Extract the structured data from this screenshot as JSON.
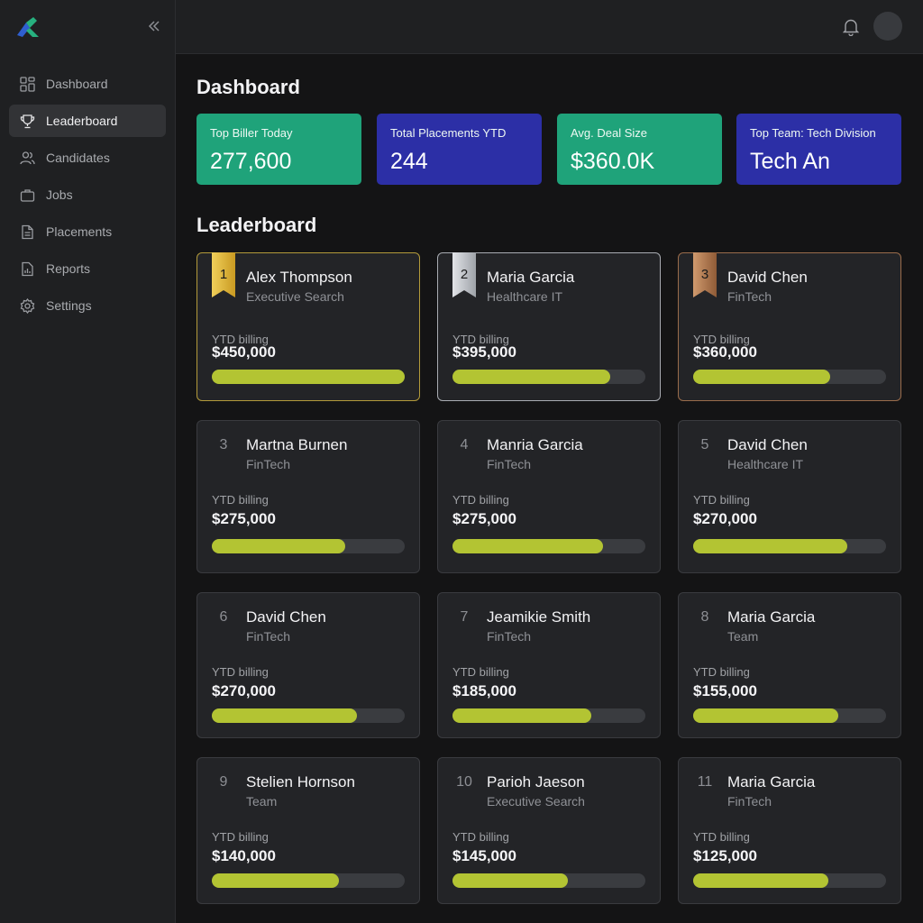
{
  "sidebar": {
    "items": [
      {
        "label": "Dashboard",
        "icon": "dashboard-icon"
      },
      {
        "label": "Leaderboard",
        "icon": "trophy-icon",
        "active": true
      },
      {
        "label": "Candidates",
        "icon": "users-icon"
      },
      {
        "label": "Jobs",
        "icon": "briefcase-icon"
      },
      {
        "label": "Placements",
        "icon": "document-icon"
      },
      {
        "label": "Reports",
        "icon": "report-icon"
      },
      {
        "label": "Settings",
        "icon": "gear-icon"
      }
    ]
  },
  "header": {
    "page_title": "Dashboard"
  },
  "stats": [
    {
      "label": "Top Biller Today",
      "value": "277,600",
      "color": "#1fa37a"
    },
    {
      "label": "Total Placements YTD",
      "value": "244",
      "color": "#2c2fa6"
    },
    {
      "label": "Avg. Deal Size",
      "value": "$360.0K",
      "color": "#1fa37a"
    },
    {
      "label": "Top Team: Tech Division",
      "value": "Tech An",
      "color": "#2c2fa6"
    }
  ],
  "leaderboard": {
    "title": "Leaderboard",
    "ytd_label": "YTD billing",
    "entries": [
      {
        "rank": "1",
        "name": "Alex Thompson",
        "team": "Executive Search",
        "amount": "$450,000",
        "progress": 1.0,
        "medal": "gold"
      },
      {
        "rank": "2",
        "name": "Maria Garcia",
        "team": "Healthcare IT",
        "amount": "$395,000",
        "progress": 0.82,
        "medal": "silver"
      },
      {
        "rank": "3",
        "name": "David Chen",
        "team": "FinTech",
        "amount": "$360,000",
        "progress": 0.71,
        "medal": "bronze"
      },
      {
        "rank": "3",
        "name": "Martna Burnen",
        "team": "FinTech",
        "amount": "$275,000",
        "progress": 0.69
      },
      {
        "rank": "4",
        "name": "Manria Garcia",
        "team": "FinTech",
        "amount": "$275,000",
        "progress": 0.78
      },
      {
        "rank": "5",
        "name": "David Chen",
        "team": "Healthcare IT",
        "amount": "$270,000",
        "progress": 0.8
      },
      {
        "rank": "6",
        "name": "David Chen",
        "team": "FinTech",
        "amount": "$270,000",
        "progress": 0.75
      },
      {
        "rank": "7",
        "name": "Jeamikie Smith",
        "team": "FinTech",
        "amount": "$185,000",
        "progress": 0.72
      },
      {
        "rank": "8",
        "name": "Maria Garcia",
        "team": "Team",
        "amount": "$155,000",
        "progress": 0.75
      },
      {
        "rank": "9",
        "name": "Stelien Hornson",
        "team": "Team",
        "amount": "$140,000",
        "progress": 0.66
      },
      {
        "rank": "10",
        "name": "Parioh Jaeson",
        "team": "Executive Search",
        "amount": "$145,000",
        "progress": 0.6
      },
      {
        "rank": "11",
        "name": "Maria Garcia",
        "team": "FinTech",
        "amount": "$125,000",
        "progress": 0.7
      }
    ]
  },
  "colors": {
    "accent_bar": "#b3c433",
    "gold": "#e2b53a",
    "silver": "#bfc2c7",
    "bronze": "#b07a52"
  }
}
